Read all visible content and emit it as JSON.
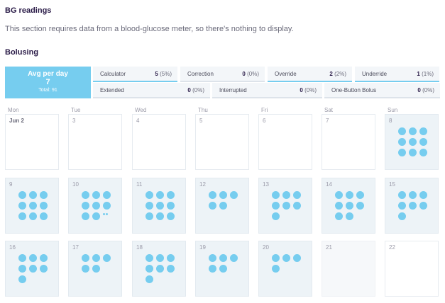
{
  "bg": {
    "title": "BG readings",
    "message": "This section requires data from a blood-glucose meter, so there's nothing to display."
  },
  "bolusing": {
    "title": "Bolusing",
    "avg": {
      "label": "Avg per day",
      "value": "7",
      "total": "Total: 91"
    },
    "stats": [
      {
        "label": "Calculator",
        "count": "5",
        "pct": "(5%)",
        "selected": true
      },
      {
        "label": "Correction",
        "count": "0",
        "pct": "(0%)",
        "selected": false
      },
      {
        "label": "Override",
        "count": "2",
        "pct": "(2%)",
        "selected": true
      },
      {
        "label": "Underride",
        "count": "1",
        "pct": "(1%)",
        "selected": true
      },
      {
        "label": "Extended",
        "count": "0",
        "pct": "(0%)",
        "selected": false
      },
      {
        "label": "Interrupted",
        "count": "0",
        "pct": "(0%)",
        "selected": false
      },
      {
        "label": "One-Button Bolus",
        "count": "0",
        "pct": "(0%)",
        "selected": false
      }
    ]
  },
  "calendar": {
    "weekdays": [
      "Mon",
      "Tue",
      "Wed",
      "Thu",
      "Fri",
      "Sat",
      "Sun"
    ],
    "weeks": [
      [
        {
          "label": "Jun 2",
          "boluses": 0,
          "extra": 0,
          "state": "plain"
        },
        {
          "label": "3",
          "boluses": 0,
          "extra": 0,
          "state": "plain"
        },
        {
          "label": "4",
          "boluses": 0,
          "extra": 0,
          "state": "plain"
        },
        {
          "label": "5",
          "boluses": 0,
          "extra": 0,
          "state": "plain"
        },
        {
          "label": "6",
          "boluses": 0,
          "extra": 0,
          "state": "plain"
        },
        {
          "label": "7",
          "boluses": 0,
          "extra": 0,
          "state": "plain"
        },
        {
          "label": "8",
          "boluses": 9,
          "extra": 0,
          "state": "data"
        }
      ],
      [
        {
          "label": "9",
          "boluses": 9,
          "extra": 0,
          "state": "data"
        },
        {
          "label": "10",
          "boluses": 8,
          "extra": 2,
          "state": "data"
        },
        {
          "label": "11",
          "boluses": 9,
          "extra": 0,
          "state": "data"
        },
        {
          "label": "12",
          "boluses": 5,
          "extra": 0,
          "state": "data"
        },
        {
          "label": "13",
          "boluses": 7,
          "extra": 0,
          "state": "data"
        },
        {
          "label": "14",
          "boluses": 8,
          "extra": 0,
          "state": "data"
        },
        {
          "label": "15",
          "boluses": 7,
          "extra": 0,
          "state": "data"
        }
      ],
      [
        {
          "label": "16",
          "boluses": 7,
          "extra": 0,
          "state": "data"
        },
        {
          "label": "17",
          "boluses": 5,
          "extra": 0,
          "state": "data"
        },
        {
          "label": "18",
          "boluses": 7,
          "extra": 0,
          "state": "data"
        },
        {
          "label": "19",
          "boluses": 5,
          "extra": 0,
          "state": "data"
        },
        {
          "label": "20",
          "boluses": 4,
          "extra": 0,
          "state": "data"
        },
        {
          "label": "21",
          "boluses": 0,
          "extra": 0,
          "state": "empty"
        },
        {
          "label": "22",
          "boluses": 0,
          "extra": 0,
          "state": "plain"
        }
      ]
    ]
  },
  "colors": {
    "accent": "#76cdef",
    "heading": "#281946",
    "cell_data": "#edf3f7"
  }
}
